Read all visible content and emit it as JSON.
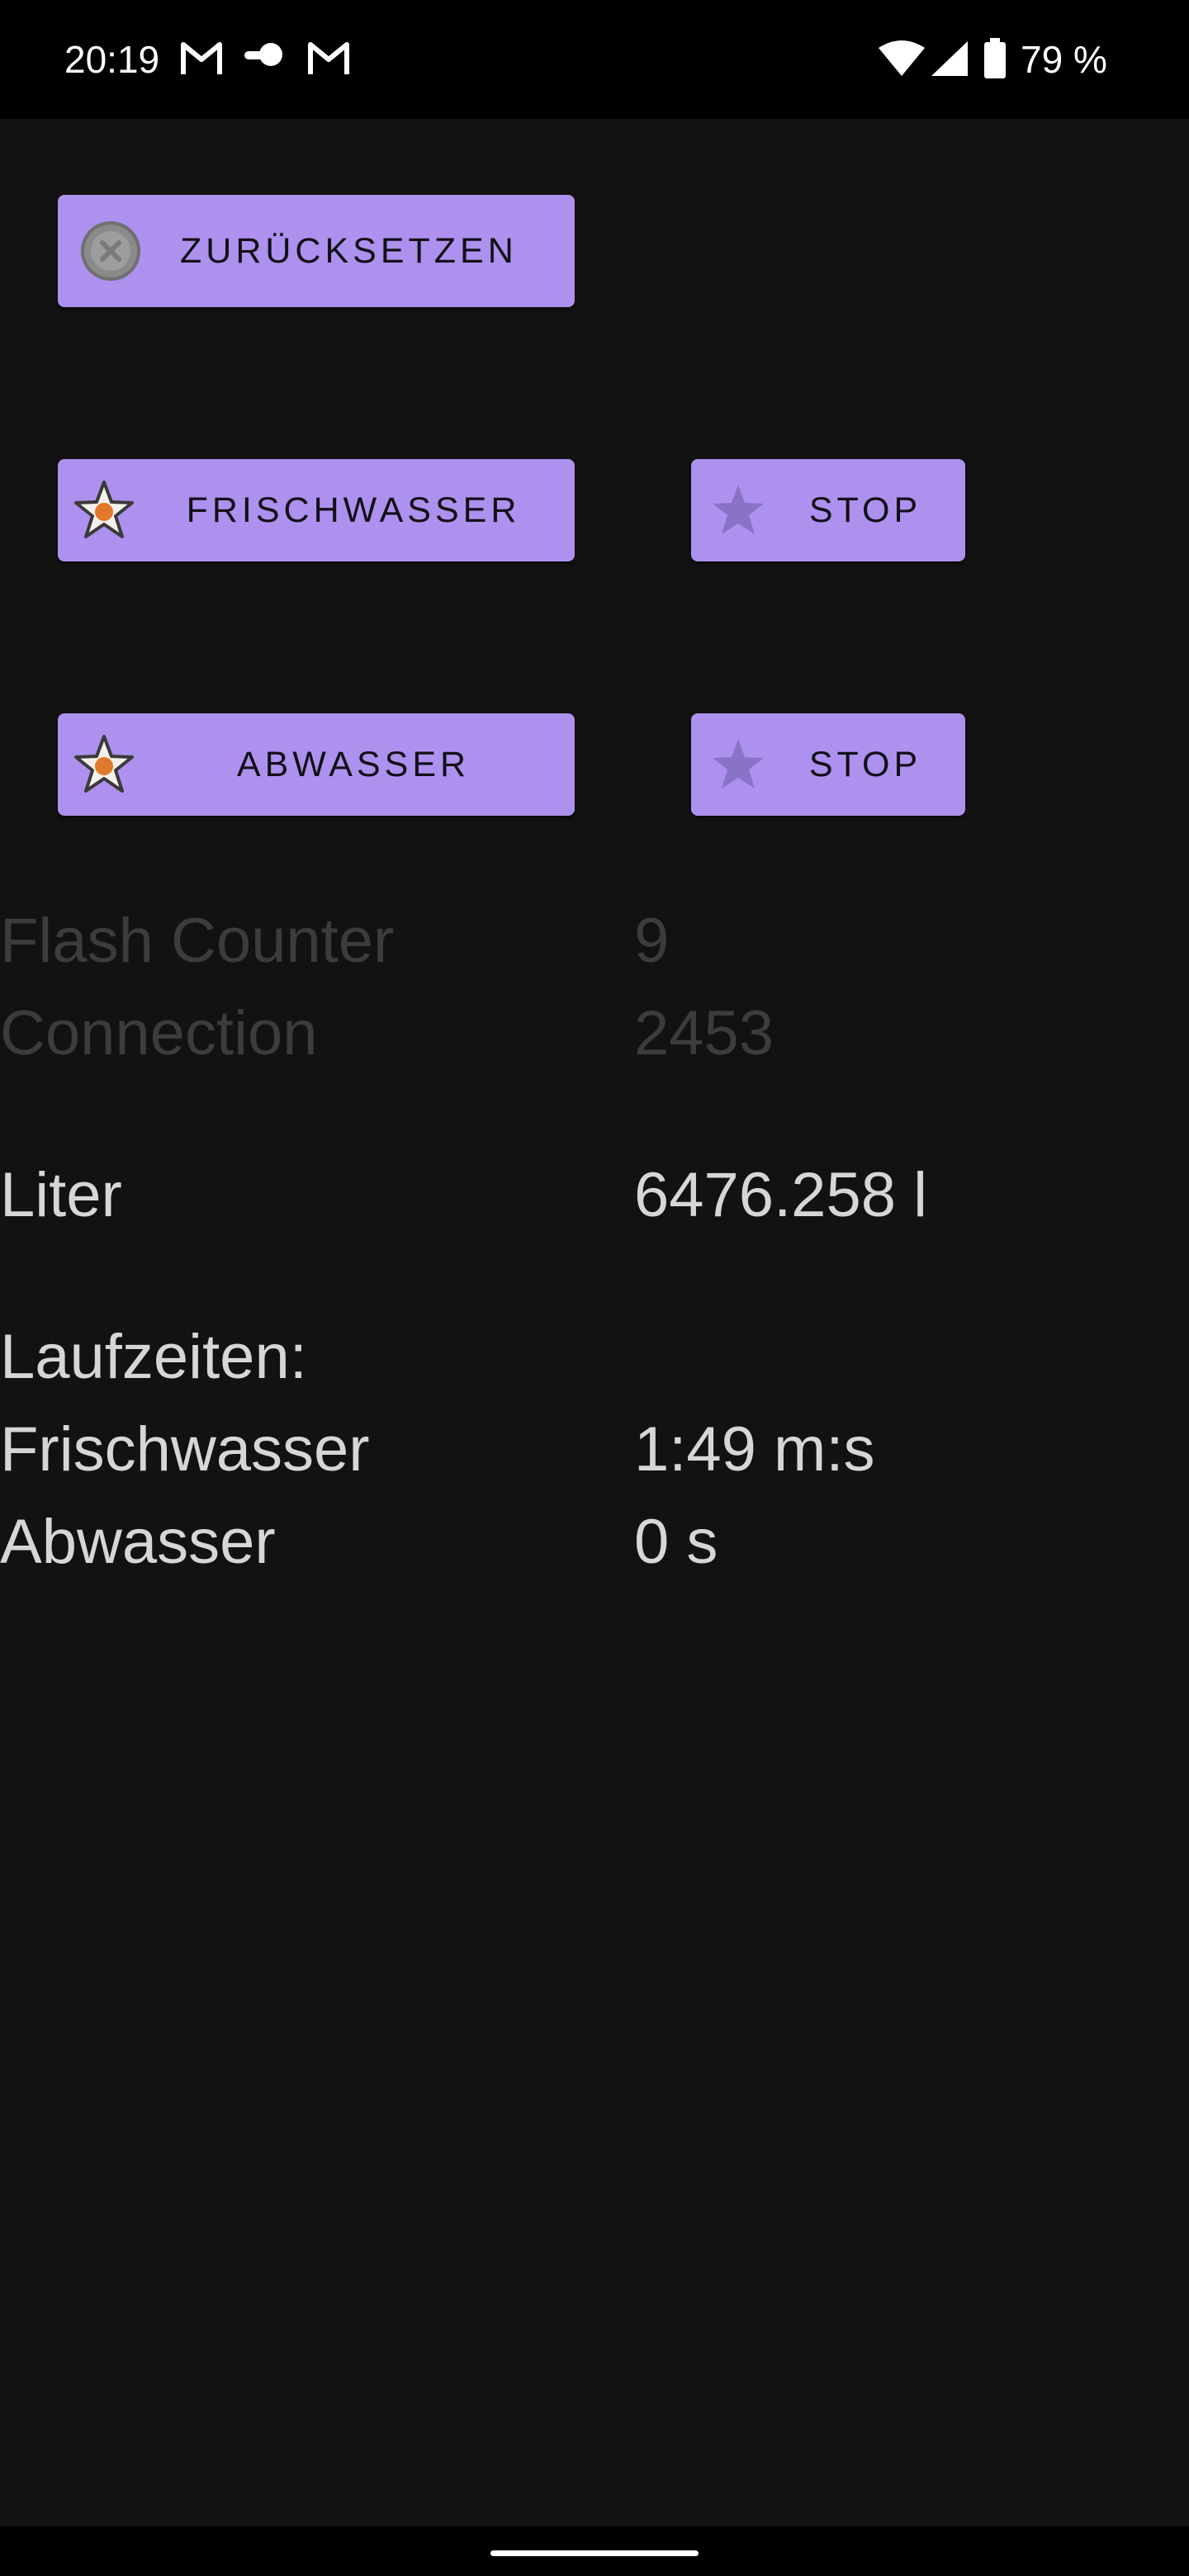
{
  "status_bar": {
    "time": "20:19",
    "notification_icons": [
      "gmail-icon",
      "cloud-icon",
      "gmail-icon"
    ],
    "system_icons": [
      "wifi-icon",
      "signal-icon",
      "battery-icon"
    ],
    "battery_percent": "79 %"
  },
  "buttons": {
    "reset": {
      "label": "ZURÜCKSETZEN",
      "icon": "reset-icon"
    },
    "fresh_water": {
      "label": "FRISCHWASSER",
      "icon": "star-active-icon"
    },
    "fresh_water_stop": {
      "label": "STOP",
      "icon": "star-inactive-icon"
    },
    "waste_water": {
      "label": "ABWASSER",
      "icon": "star-active-icon"
    },
    "waste_water_stop": {
      "label": "STOP",
      "icon": "star-inactive-icon"
    }
  },
  "info": {
    "flash_counter": {
      "label": "Flash Counter",
      "value": "9"
    },
    "connection": {
      "label": "Connection",
      "value": "2453"
    },
    "liter": {
      "label": "Liter",
      "value": "6476.258 l"
    },
    "runtimes_heading": "Laufzeiten:",
    "fresh_water_runtime": {
      "label": "Frischwasser",
      "value": "1:49 m:s"
    },
    "waste_water_runtime": {
      "label": "Abwasser",
      "value": "0 s"
    }
  },
  "colors": {
    "background": "#121212",
    "button": "#ae91ee",
    "button_text": "#120f18",
    "dim_text": "#3c3c3c",
    "text": "#d6d6d6",
    "status_bar": "#000000"
  }
}
